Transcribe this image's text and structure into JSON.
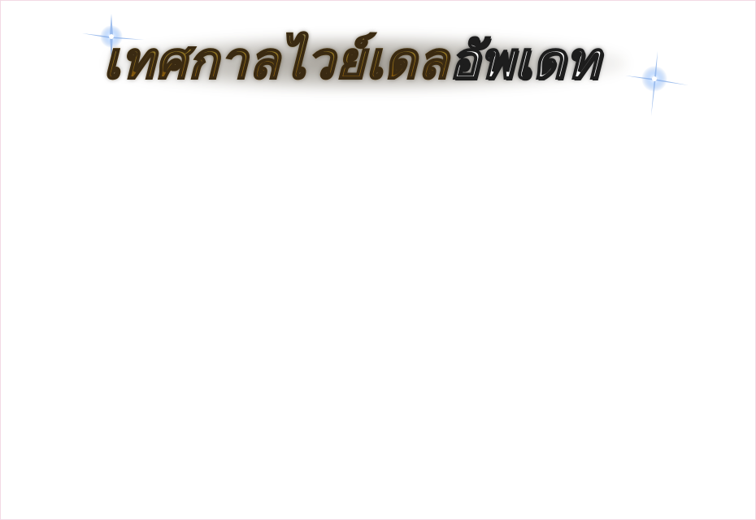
{
  "banner": {
    "title_gold": "เทศกาลไวย์เดล",
    "title_white": "อัพเดท"
  },
  "colors": {
    "background": "#ffffff",
    "gold": "#f7c02e",
    "outline": "#3a2a12",
    "sparkle": "#9ec4ff"
  },
  "icons": {
    "sparkle_left": "sparkle-icon",
    "sparkle_right": "sparkle-icon"
  }
}
